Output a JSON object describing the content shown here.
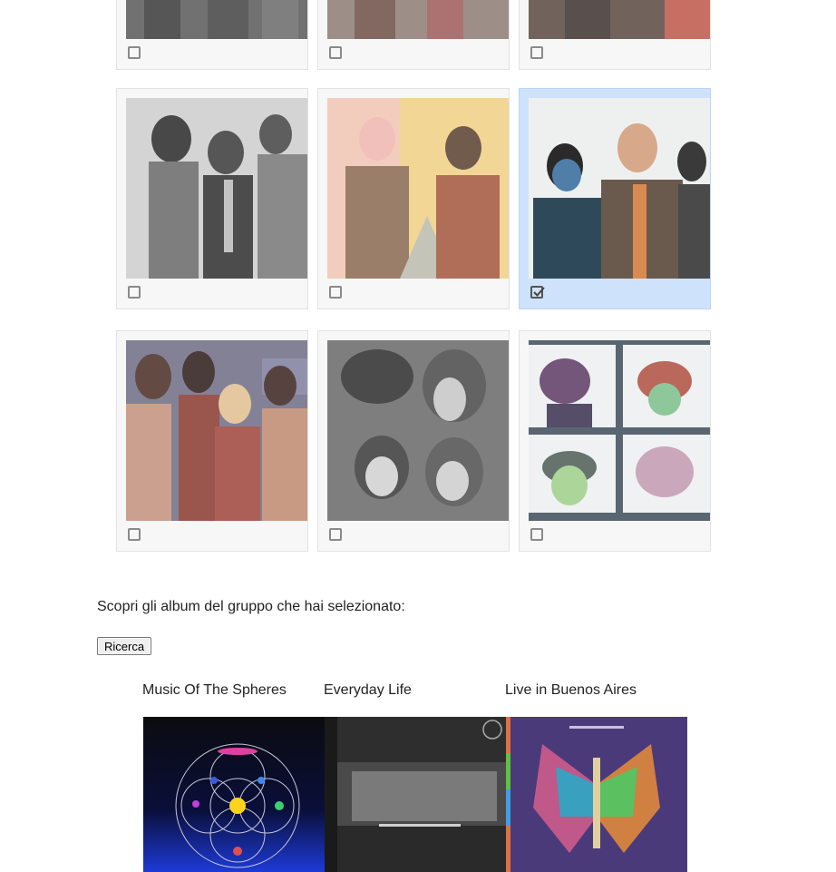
{
  "prompt": "Scopri gli album del gruppo che hai selezionato:",
  "search_button": "Ricerca",
  "selection": {
    "selected_index": 5,
    "cards": [
      {
        "id": "band-1",
        "checked": false
      },
      {
        "id": "band-2",
        "checked": false
      },
      {
        "id": "band-3",
        "checked": false
      },
      {
        "id": "acdc",
        "checked": false
      },
      {
        "id": "twenty-one-pilots",
        "checked": false
      },
      {
        "id": "coldplay",
        "checked": true
      },
      {
        "id": "maneskin",
        "checked": false
      },
      {
        "id": "pink-floyd",
        "checked": false
      },
      {
        "id": "gorillaz",
        "checked": false
      }
    ]
  },
  "albums": [
    {
      "title": "Music Of The Spheres"
    },
    {
      "title": "Everyday Life"
    },
    {
      "title": "Live in Buenos Aires"
    }
  ],
  "colors": {
    "selected_card": "#cfe2fb",
    "card": "#f7f7f7",
    "checkbox": "#8a8a8a"
  }
}
